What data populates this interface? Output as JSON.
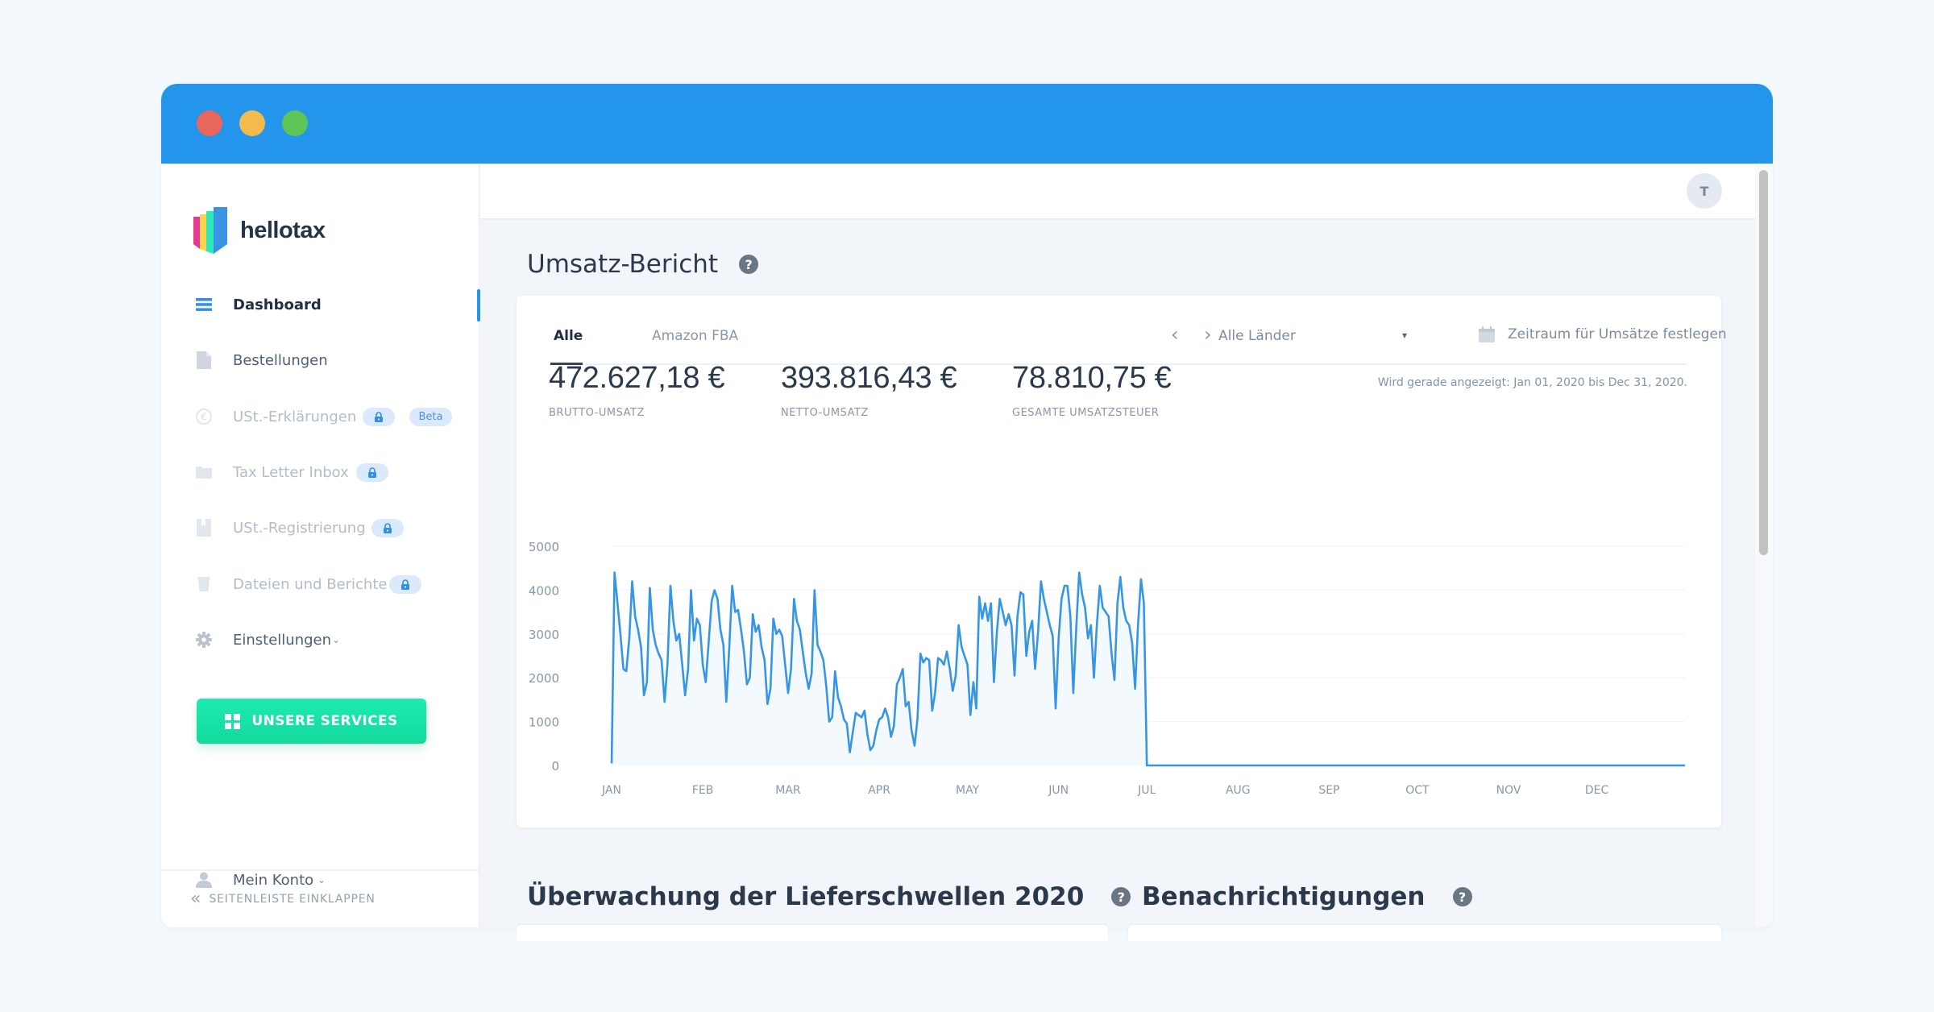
{
  "window": {
    "traffic_lights": [
      "close",
      "minimize",
      "maximize"
    ]
  },
  "brand": {
    "name": "hellotax",
    "logo_colors": [
      "#e8388f",
      "#fdd34d",
      "#2ee8b8",
      "#3a94e6"
    ]
  },
  "sidebar": {
    "items": [
      {
        "label": "Dashboard",
        "icon": "menu-lines-icon",
        "active": true,
        "locked": false
      },
      {
        "label": "Bestellungen",
        "icon": "document-icon",
        "active": false,
        "locked": false
      },
      {
        "label": "USt.-Erklärungen",
        "icon": "euro-refresh-icon",
        "active": false,
        "locked": true,
        "badge": "Beta"
      },
      {
        "label": "Tax Letter Inbox",
        "icon": "folder-icon",
        "active": false,
        "locked": true
      },
      {
        "label": "USt.-Registrierung",
        "icon": "bookmark-icon",
        "active": false,
        "locked": true
      },
      {
        "label": "Dateien und Berichte",
        "icon": "bin-icon",
        "active": false,
        "locked": true
      },
      {
        "label": "Einstellungen",
        "icon": "gear-icon",
        "active": false,
        "locked": false,
        "expandable": true
      }
    ],
    "services_button": "UNSERE SERVICES",
    "account": {
      "label": "Mein Konto",
      "icon": "user-icon",
      "expandable": true
    },
    "collapse_label": "SEITENLEISTE EINKLAPPEN"
  },
  "header": {
    "avatar_initial": "T"
  },
  "report": {
    "title": "Umsatz-Bericht",
    "tabs": [
      {
        "label": "Alle",
        "active": true
      },
      {
        "label": "Amazon FBA",
        "active": false
      }
    ],
    "prev_label": "‹",
    "next_label": "›",
    "country_select": "Alle Länder",
    "period_button": "Zeitraum für Umsätze festlegen",
    "showing_text": "Wird gerade angezeigt: Jan 01, 2020 bis Dec 31, 2020.",
    "stats": [
      {
        "value": "472.627,18 €",
        "label": "BRUTTO-UMSATZ"
      },
      {
        "value": "393.816,43 €",
        "label": "NETTO-UMSATZ"
      },
      {
        "value": "78.810,75 €",
        "label": "GESAMTE UMSATZSTEUER"
      }
    ],
    "colors": {
      "line": "#3796e4",
      "fill": "#f4f9fd",
      "grid": "#f3f5f8",
      "axis_text": "#8a97a7"
    }
  },
  "sections": [
    {
      "title": "Überwachung der Lieferschwellen 2020"
    },
    {
      "title": "Benachrichtigungen"
    }
  ],
  "chart_data": {
    "type": "area",
    "title": "",
    "xlabel": "",
    "ylabel": "",
    "ylim": [
      0,
      5000
    ],
    "yticks": [
      0,
      1000,
      2000,
      3000,
      4000,
      5000
    ],
    "xticks": [
      "JAN",
      "FEB",
      "MAR",
      "APR",
      "MAY",
      "JUN",
      "JUL",
      "AUG",
      "SEP",
      "OCT",
      "NOV",
      "DEC"
    ],
    "x_range": [
      "2020-01-01",
      "2020-12-31"
    ],
    "grid": true,
    "legend": "none",
    "series": [
      {
        "name": "Umsatz (daily)",
        "months": {
          "JAN": [
            50,
            4400,
            3700,
            3000,
            2200,
            2150,
            2900,
            4200,
            3400,
            3100,
            2700,
            1600,
            1900,
            4050,
            3100,
            2750,
            2550,
            2400,
            1450,
            2300,
            4100,
            3300,
            2850,
            3000,
            2300,
            1600,
            2200,
            4000,
            2850,
            3350,
            3200
          ],
          "FEB": [
            2300,
            1900,
            2800,
            3750,
            4000,
            3800,
            3100,
            2750,
            1450,
            2700,
            4100,
            3500,
            3550,
            3100,
            2600,
            1850,
            2000,
            3450,
            3050,
            3200,
            2700,
            2400,
            1400,
            1750,
            3350,
            3000,
            3100,
            2950,
            2300
          ],
          "MAR": [
            1650,
            2200,
            3800,
            3300,
            3100,
            2600,
            2100,
            1750,
            2100,
            4000,
            2750,
            2600,
            2400,
            1800,
            1000,
            1100,
            2150,
            1550,
            1350,
            1050,
            950,
            300,
            750,
            1200,
            1150,
            1100,
            1250,
            700,
            350,
            450,
            800
          ],
          "APR": [
            1050,
            1100,
            1300,
            1100,
            650,
            900,
            1850,
            2000,
            2200,
            1350,
            1450,
            800,
            450,
            1050,
            2550,
            2350,
            2450,
            2400,
            1250,
            1650,
            2450,
            2400,
            2300,
            2600,
            2200,
            1700,
            2050,
            3200,
            2700,
            2500
          ],
          "MAY": [
            2300,
            1150,
            1900,
            1300,
            3850,
            3350,
            3700,
            3300,
            3700,
            1900,
            3050,
            3800,
            3500,
            3200,
            3450,
            3200,
            2050,
            3400,
            3950,
            3900,
            2500,
            3050,
            3300,
            2200,
            3050,
            4200,
            3800,
            3500,
            3200,
            2950,
            1300
          ],
          "JUN": [
            2900,
            3800,
            4100,
            4100,
            3400,
            1650,
            3150,
            4400,
            3900,
            3600,
            2900,
            3200,
            2000,
            3200,
            4100,
            3600,
            3500,
            3400,
            2550,
            1950,
            3700,
            4300,
            3600,
            3300,
            3200,
            2800,
            1750,
            3200,
            4250,
            3700
          ],
          "JUL": [
            0
          ],
          "AUG": [
            0
          ],
          "SEP": [
            0
          ],
          "OCT": [
            0
          ],
          "NOV": [
            0
          ],
          "DEC": [
            0
          ]
        }
      }
    ]
  }
}
